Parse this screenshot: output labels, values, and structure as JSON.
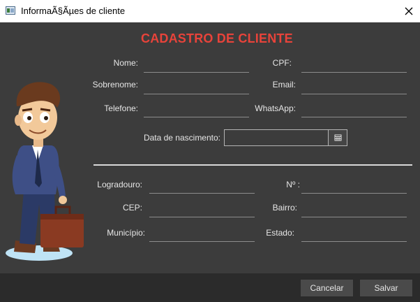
{
  "window": {
    "title": "InformaÃ§Ãµes de cliente"
  },
  "form": {
    "heading": "CADASTRO DE CLIENTE",
    "nome_label": "Nome:",
    "cpf_label": "CPF:",
    "sobrenome_label": "Sobrenome:",
    "email_label": "Email:",
    "telefone_label": "Telefone:",
    "whatsapp_label": "WhatsApp:",
    "nascimento_label": "Data de nascimento:",
    "logradouro_label": "Logradouro:",
    "numero_label": "Nº :",
    "cep_label": "CEP:",
    "bairro_label": "Bairro:",
    "municipio_label": "Município:",
    "estado_label": "Estado:"
  },
  "footer": {
    "cancel_label": "Cancelar",
    "save_label": "Salvar"
  },
  "colors": {
    "heading": "#e8433a",
    "background": "#3c3c3c",
    "footer": "#2b2b2b"
  },
  "icons": {
    "close": "close-icon",
    "calendar": "calendar-icon",
    "app": "app-window-icon"
  }
}
